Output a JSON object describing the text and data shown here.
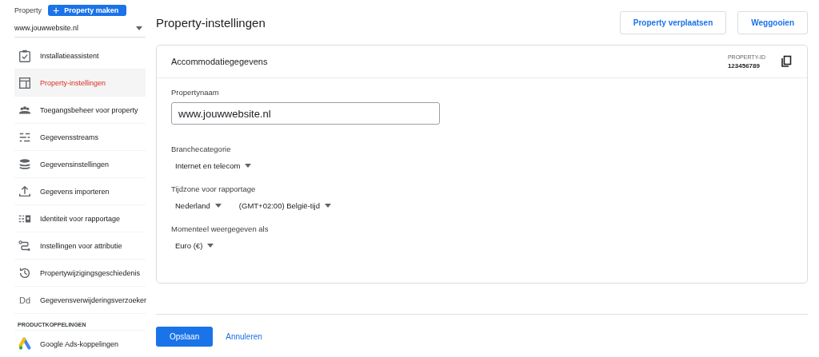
{
  "sidebar": {
    "property_label": "Property",
    "create_button": {
      "icon": "+",
      "label": "Property maken"
    },
    "property_select": "www.jouwwebsite.nl",
    "items": [
      {
        "label": "Installatieassistent",
        "selected": false
      },
      {
        "label": "Property-instellingen",
        "selected": true
      },
      {
        "label": "Toegangsbeheer voor property",
        "selected": false
      },
      {
        "label": "Gegevensstreams",
        "selected": false
      },
      {
        "label": "Gegevensinstellingen",
        "selected": false
      },
      {
        "label": "Gegevens importeren",
        "selected": false
      },
      {
        "label": "Identiteit voor rapportage",
        "selected": false
      },
      {
        "label": "Instellingen voor attributie",
        "selected": false
      },
      {
        "label": "Propertywijzigingsgeschiedenis",
        "selected": false
      },
      {
        "label": "Gegevensverwijderingsverzoeker",
        "selected": false,
        "icon_text": "Dd"
      }
    ],
    "section_heading": "PRODUCTKOPPELINGEN",
    "section_items": [
      {
        "label": "Google Ads-koppelingen",
        "selected": false
      }
    ]
  },
  "page": {
    "title": "Property-instellingen",
    "actions": [
      "Property verplaatsen",
      "Weggooien"
    ],
    "card": {
      "title": "Accommodatiegegevens",
      "id_label": "PROPERTY-ID",
      "id_value": "123456789",
      "name_label": "Propertynaam",
      "name_value": "www.jouwwebsite.nl",
      "fields": [
        {
          "label": "Branchecategorie",
          "dropdowns": [
            "Internet en telecom"
          ]
        },
        {
          "label": "Tijdzone voor rapportage",
          "dropdowns": [
            "Nederland",
            "(GMT+02:00) België-tijd"
          ]
        },
        {
          "label": "Momenteel weergegeven als",
          "dropdowns": [
            "Euro (€)"
          ]
        }
      ]
    },
    "save_button": "Opslaan",
    "cancel_button": "Annuleren"
  }
}
